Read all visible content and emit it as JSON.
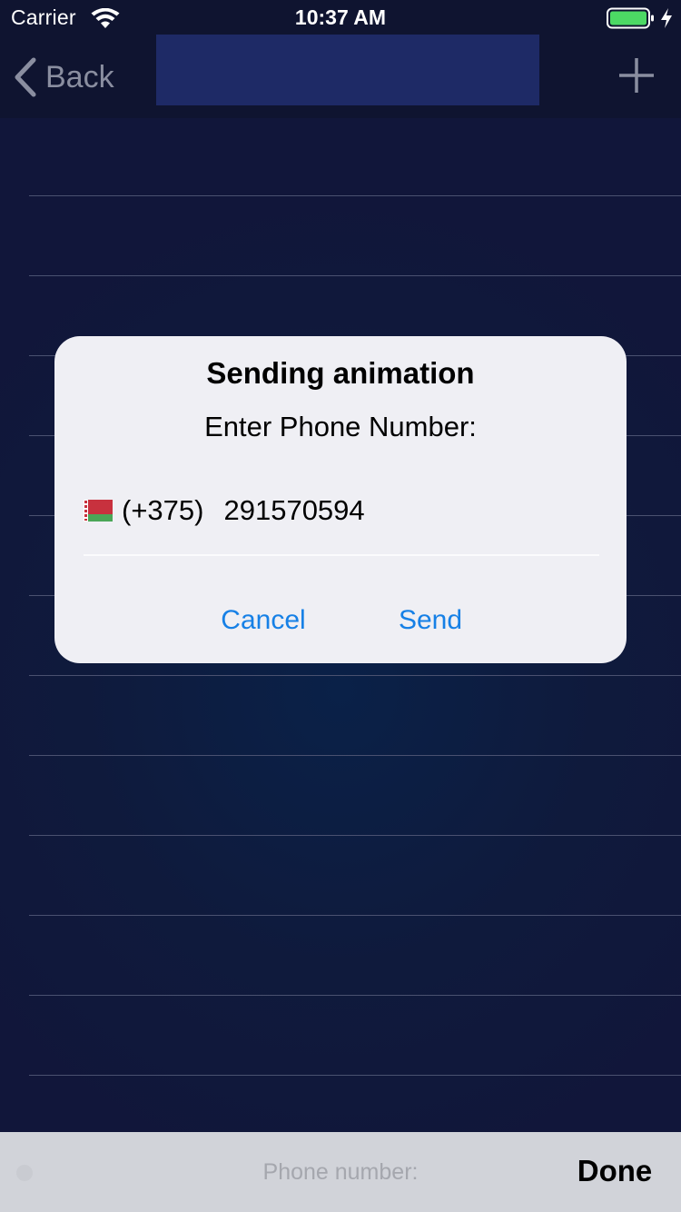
{
  "status_bar": {
    "carrier": "Carrier",
    "time": "10:37 AM",
    "battery_color": "#4cd964"
  },
  "nav": {
    "back_label": "Back",
    "back_icon": "chevron-left-icon",
    "add_icon": "plus-icon",
    "title_box_color": "#1e2a66"
  },
  "alert": {
    "title": "Sending animation",
    "message": "Enter Phone Number:",
    "country_flag": "belarus-flag-icon",
    "country_code": "(+375)",
    "phone_number": "291570594",
    "cancel_label": "Cancel",
    "send_label": "Send",
    "accent_color": "#1680e6"
  },
  "keyboard_toolbar": {
    "placeholder": "Phone number:",
    "done_label": "Done"
  },
  "colors": {
    "background": "#0f1738",
    "nav_background": "#0f1430",
    "alert_background": "#efeff4",
    "toolbar_background": "#d1d3d9"
  }
}
